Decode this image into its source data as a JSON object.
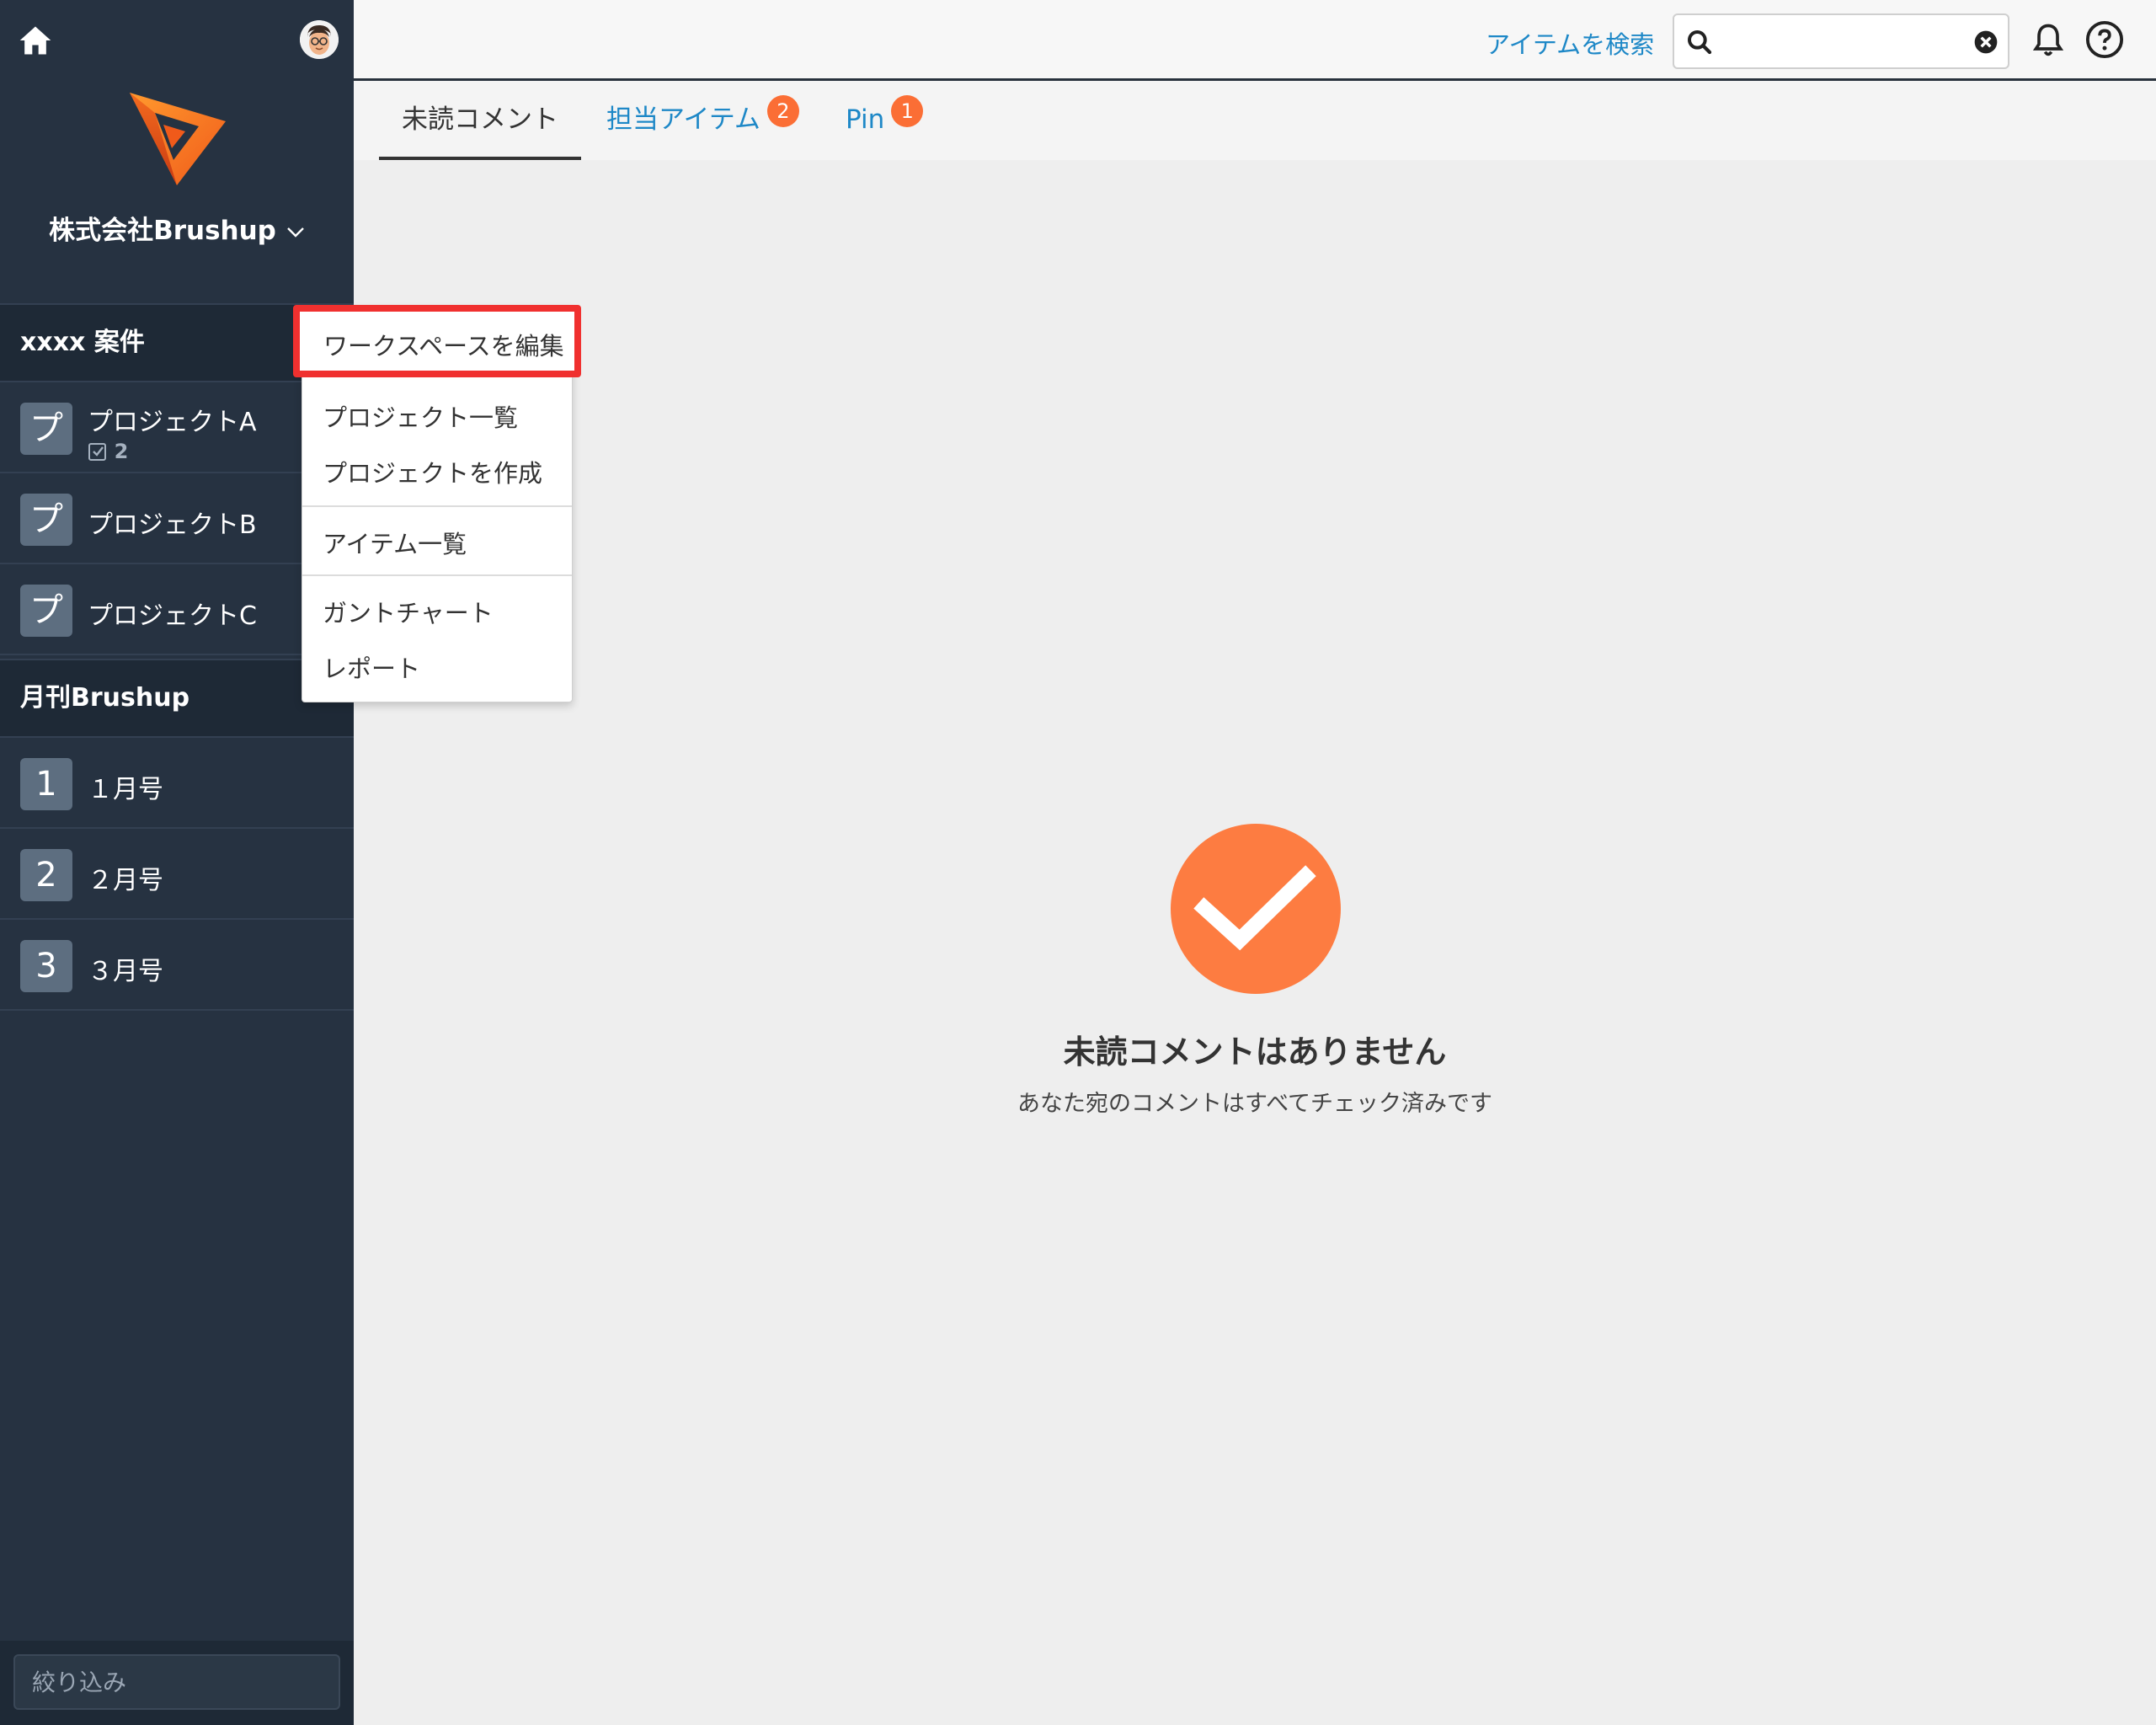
{
  "sidebar": {
    "org_name": "株式会社Brushup",
    "workspaces": [
      {
        "name": "xxxx 案件",
        "projects": [
          {
            "tile": "プ",
            "label": "プロジェクトA",
            "count": "2"
          },
          {
            "tile": "プ",
            "label": "プロジェクトB"
          },
          {
            "tile": "プ",
            "label": "プロジェクトC"
          }
        ]
      },
      {
        "name": "月刊Brushup",
        "projects": [
          {
            "tile": "1",
            "label": "１月号"
          },
          {
            "tile": "2",
            "label": "２月号"
          },
          {
            "tile": "3",
            "label": "３月号"
          }
        ]
      }
    ],
    "filter_placeholder": "絞り込み"
  },
  "topbar": {
    "search_link": "アイテムを検索",
    "search_value": ""
  },
  "tabs": [
    {
      "label": "未読コメント",
      "active": true
    },
    {
      "label": "担当アイテム",
      "badge": "2"
    },
    {
      "label": "Pin",
      "badge": "1"
    }
  ],
  "empty_state": {
    "title": "未読コメントはありません",
    "subtitle": "あなた宛のコメントはすべてチェック済みです"
  },
  "menu": {
    "edit_workspace": "ワークスペースを編集",
    "project_list": "プロジェクト一覧",
    "create_project": "プロジェクトを作成",
    "item_list": "アイテム一覧",
    "gantt_chart": "ガントチャート",
    "report": "レポート"
  },
  "colors": {
    "sidebar_bg": "#263241",
    "accent_orange": "#fd7c41",
    "badge_orange": "#fb6e35",
    "link_blue": "#1e88c7",
    "highlight_red": "#f0302f"
  }
}
